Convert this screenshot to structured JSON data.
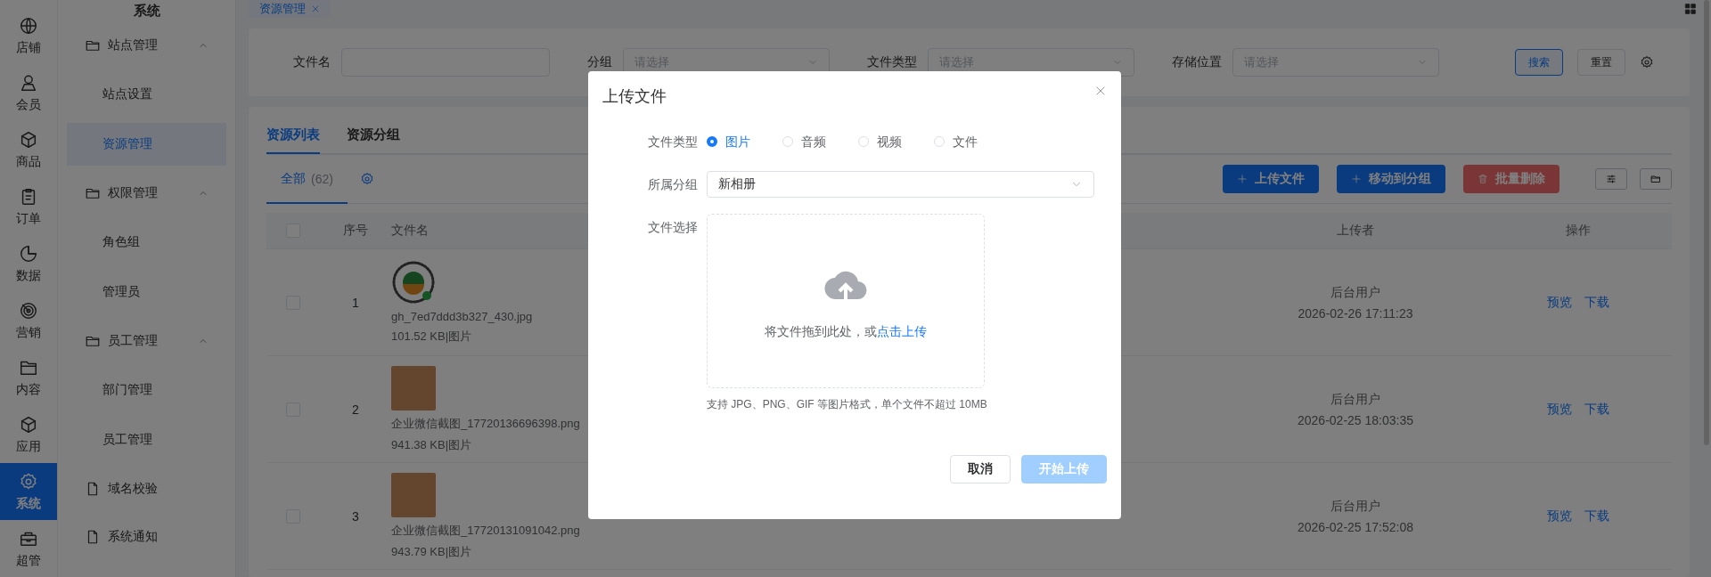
{
  "nav_rail": [
    {
      "label": "店铺",
      "selected": false
    },
    {
      "label": "会员",
      "selected": false
    },
    {
      "label": "商品",
      "selected": false
    },
    {
      "label": "订单",
      "selected": false
    },
    {
      "label": "数据",
      "selected": false
    },
    {
      "label": "营销",
      "selected": false
    },
    {
      "label": "内容",
      "selected": false
    },
    {
      "label": "应用",
      "selected": false
    },
    {
      "label": "系统",
      "selected": true
    },
    {
      "label": "超管",
      "selected": false
    }
  ],
  "sub_nav": {
    "title": "系统",
    "items": [
      {
        "label": "站点管理",
        "kind": "folder",
        "expanded": true,
        "children": [
          {
            "label": "站点设置",
            "selected": false
          },
          {
            "label": "资源管理",
            "selected": true
          }
        ]
      },
      {
        "label": "权限管理",
        "kind": "folder",
        "expanded": true,
        "children": [
          {
            "label": "角色组",
            "selected": false
          },
          {
            "label": "管理员",
            "selected": false
          }
        ]
      },
      {
        "label": "员工管理",
        "kind": "folder",
        "expanded": true,
        "children": [
          {
            "label": "部门管理",
            "selected": false
          },
          {
            "label": "员工管理",
            "selected": false
          }
        ]
      },
      {
        "label": "域名校验",
        "kind": "page"
      },
      {
        "label": "系统通知",
        "kind": "page"
      }
    ]
  },
  "page_tabs": [
    {
      "label": "资源管理",
      "selected": true
    }
  ],
  "filters": [
    {
      "label": "文件名",
      "kind": "text"
    },
    {
      "label": "分组",
      "kind": "select",
      "placeholder": "请选择"
    },
    {
      "label": "文件类型",
      "kind": "select",
      "placeholder": "请选择"
    },
    {
      "label": "存储位置",
      "kind": "select",
      "placeholder": "请选择"
    }
  ],
  "filter_buttons": {
    "search": "搜索",
    "reset": "重置"
  },
  "content_tabs": [
    {
      "label": "资源列表",
      "selected": true
    },
    {
      "label": "资源分组",
      "selected": false
    }
  ],
  "group_tabs": [
    {
      "label": "全部",
      "count": "(62)",
      "selected": true
    }
  ],
  "toolbar_buttons": [
    {
      "label": "上传文件",
      "kind": "primary"
    },
    {
      "label": "移动到分组",
      "kind": "primary"
    },
    {
      "label": "批量删除",
      "kind": "danger"
    }
  ],
  "table": {
    "header_checked": false,
    "columns": [
      "序号",
      "文件名",
      "上传者",
      "操作"
    ],
    "rows": [
      {
        "checked": false,
        "index": "1",
        "file_name": "gh_7ed7ddd3b327_430.jpg",
        "file_meta": "101.52 KB|图片",
        "uploader": "后台用户",
        "uploaded_at": "2026-02-26 17:11:23",
        "actions": [
          "预览",
          "下载"
        ]
      },
      {
        "checked": false,
        "index": "2",
        "file_name": "企业微信截图_17720136696398.png",
        "file_meta": "941.38 KB|图片",
        "uploader": "后台用户",
        "uploaded_at": "2026-02-25 18:03:35",
        "actions": [
          "预览",
          "下载"
        ]
      },
      {
        "checked": false,
        "index": "3",
        "file_name": "企业微信截图_17720131091042.png",
        "file_meta": "943.79 KB|图片",
        "uploader": "后台用户",
        "uploaded_at": "2026-02-25 17:52:08",
        "actions": [
          "预览",
          "下载"
        ]
      }
    ]
  },
  "modal": {
    "title": "上传文件",
    "fields": [
      {
        "label": "文件类型",
        "kind": "radio",
        "options": [
          {
            "label": "图片",
            "selected": true
          },
          {
            "label": "音频",
            "selected": false
          },
          {
            "label": "视频",
            "selected": false
          },
          {
            "label": "文件",
            "selected": false
          }
        ]
      },
      {
        "label": "所属分组",
        "kind": "select",
        "value": "新相册"
      },
      {
        "label": "文件选择",
        "kind": "dropzone",
        "text": "将文件拖到此处，或",
        "link": "点击上传",
        "hint": "支持 JPG、PNG、GIF 等图片格式，单个文件不超过 10MB"
      }
    ],
    "buttons": [
      {
        "label": "取消",
        "kind": "default"
      },
      {
        "label": "开始上传",
        "kind": "primary",
        "disabled": true
      }
    ]
  }
}
